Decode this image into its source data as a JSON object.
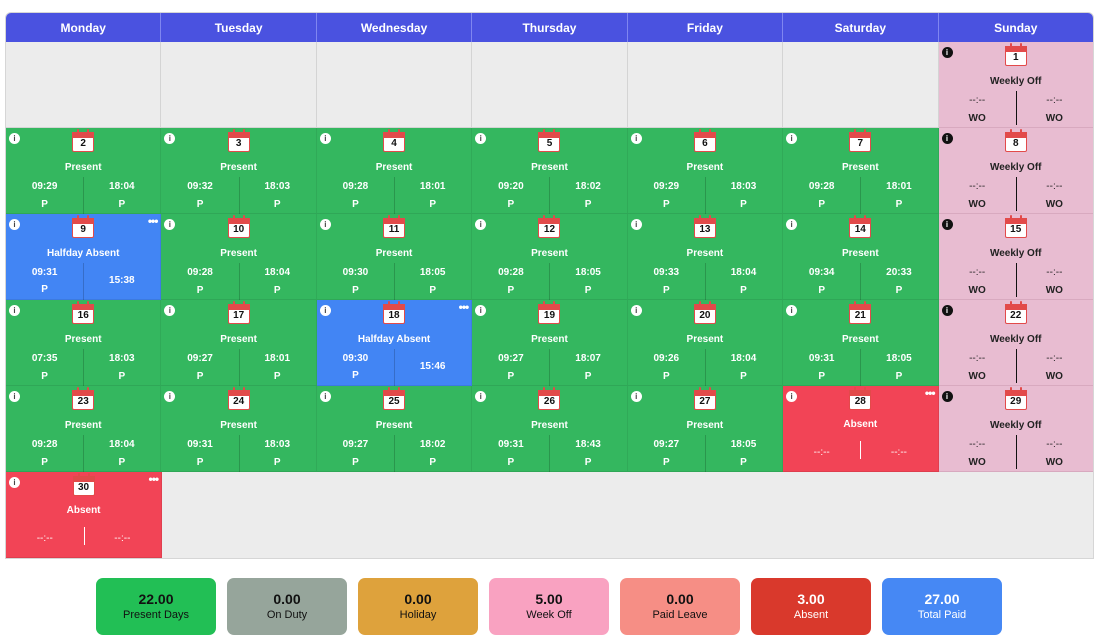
{
  "days": [
    "Monday",
    "Tuesday",
    "Wednesday",
    "Thursday",
    "Friday",
    "Saturday",
    "Sunday"
  ],
  "weeks": [
    [
      {
        "type": "empty"
      },
      {
        "type": "empty"
      },
      {
        "type": "empty"
      },
      {
        "type": "empty"
      },
      {
        "type": "empty"
      },
      {
        "type": "empty"
      },
      {
        "type": "weekoff",
        "date": "1",
        "status": "Weekly Off",
        "in": "--:--",
        "out": "--:--",
        "in_mark": "WO",
        "out_mark": "WO"
      }
    ],
    [
      {
        "type": "present",
        "date": "2",
        "status": "Present",
        "in": "09:29",
        "out": "18:04",
        "in_mark": "P",
        "out_mark": "P"
      },
      {
        "type": "present",
        "date": "3",
        "status": "Present",
        "in": "09:32",
        "out": "18:03",
        "in_mark": "P",
        "out_mark": "P"
      },
      {
        "type": "present",
        "date": "4",
        "status": "Present",
        "in": "09:28",
        "out": "18:01",
        "in_mark": "P",
        "out_mark": "P"
      },
      {
        "type": "present",
        "date": "5",
        "status": "Present",
        "in": "09:20",
        "out": "18:02",
        "in_mark": "P",
        "out_mark": "P"
      },
      {
        "type": "present",
        "date": "6",
        "status": "Present",
        "in": "09:29",
        "out": "18:03",
        "in_mark": "P",
        "out_mark": "P"
      },
      {
        "type": "present",
        "date": "7",
        "status": "Present",
        "in": "09:28",
        "out": "18:01",
        "in_mark": "P",
        "out_mark": "P"
      },
      {
        "type": "weekoff",
        "date": "8",
        "status": "Weekly Off",
        "in": "--:--",
        "out": "--:--",
        "in_mark": "WO",
        "out_mark": "WO"
      }
    ],
    [
      {
        "type": "halfday",
        "date": "9",
        "status": "Halfday Absent",
        "in": "09:31",
        "out": "15:38",
        "in_mark": "P",
        "out_mark": "",
        "more": "•••"
      },
      {
        "type": "present",
        "date": "10",
        "status": "Present",
        "in": "09:28",
        "out": "18:04",
        "in_mark": "P",
        "out_mark": "P"
      },
      {
        "type": "present",
        "date": "11",
        "status": "Present",
        "in": "09:30",
        "out": "18:05",
        "in_mark": "P",
        "out_mark": "P"
      },
      {
        "type": "present",
        "date": "12",
        "status": "Present",
        "in": "09:28",
        "out": "18:05",
        "in_mark": "P",
        "out_mark": "P"
      },
      {
        "type": "present",
        "date": "13",
        "status": "Present",
        "in": "09:33",
        "out": "18:04",
        "in_mark": "P",
        "out_mark": "P"
      },
      {
        "type": "present",
        "date": "14",
        "status": "Present",
        "in": "09:34",
        "out": "20:33",
        "in_mark": "P",
        "out_mark": "P"
      },
      {
        "type": "weekoff",
        "date": "15",
        "status": "Weekly Off",
        "in": "--:--",
        "out": "--:--",
        "in_mark": "WO",
        "out_mark": "WO"
      }
    ],
    [
      {
        "type": "present",
        "date": "16",
        "status": "Present",
        "in": "07:35",
        "out": "18:03",
        "in_mark": "P",
        "out_mark": "P"
      },
      {
        "type": "present",
        "date": "17",
        "status": "Present",
        "in": "09:27",
        "out": "18:01",
        "in_mark": "P",
        "out_mark": "P"
      },
      {
        "type": "halfday",
        "date": "18",
        "status": "Halfday Absent",
        "in": "09:30",
        "out": "15:46",
        "in_mark": "P",
        "out_mark": "",
        "more": "•••"
      },
      {
        "type": "present",
        "date": "19",
        "status": "Present",
        "in": "09:27",
        "out": "18:07",
        "in_mark": "P",
        "out_mark": "P"
      },
      {
        "type": "present",
        "date": "20",
        "status": "Present",
        "in": "09:26",
        "out": "18:04",
        "in_mark": "P",
        "out_mark": "P"
      },
      {
        "type": "present",
        "date": "21",
        "status": "Present",
        "in": "09:31",
        "out": "18:05",
        "in_mark": "P",
        "out_mark": "P"
      },
      {
        "type": "weekoff",
        "date": "22",
        "status": "Weekly Off",
        "in": "--:--",
        "out": "--:--",
        "in_mark": "WO",
        "out_mark": "WO"
      }
    ],
    [
      {
        "type": "present",
        "date": "23",
        "status": "Present",
        "in": "09:28",
        "out": "18:04",
        "in_mark": "P",
        "out_mark": "P"
      },
      {
        "type": "present",
        "date": "24",
        "status": "Present",
        "in": "09:31",
        "out": "18:03",
        "in_mark": "P",
        "out_mark": "P"
      },
      {
        "type": "present",
        "date": "25",
        "status": "Present",
        "in": "09:27",
        "out": "18:02",
        "in_mark": "P",
        "out_mark": "P"
      },
      {
        "type": "present",
        "date": "26",
        "status": "Present",
        "in": "09:31",
        "out": "18:43",
        "in_mark": "P",
        "out_mark": "P"
      },
      {
        "type": "present",
        "date": "27",
        "status": "Present",
        "in": "09:27",
        "out": "18:05",
        "in_mark": "P",
        "out_mark": "P"
      },
      {
        "type": "absent",
        "date": "28",
        "status": "Absent",
        "in": "--:--",
        "out": "--:--",
        "in_mark": "",
        "out_mark": "",
        "more": "•••"
      },
      {
        "type": "weekoff",
        "date": "29",
        "status": "Weekly Off",
        "in": "--:--",
        "out": "--:--",
        "in_mark": "WO",
        "out_mark": "WO"
      }
    ],
    [
      {
        "type": "absent",
        "date": "30",
        "status": "Absent",
        "in": "--:--",
        "out": "--:--",
        "in_mark": "",
        "out_mark": "",
        "more": "•••"
      },
      {
        "type": "empty"
      },
      {
        "type": "empty"
      },
      {
        "type": "empty"
      },
      {
        "type": "empty"
      },
      {
        "type": "empty"
      },
      {
        "type": "empty"
      }
    ]
  ],
  "info_glyph": "i",
  "summary": [
    {
      "value": "22.00",
      "label": "Present Days",
      "bg": "#22bf55",
      "fg": "#111111"
    },
    {
      "value": "0.00",
      "label": "On Duty",
      "bg": "#96a59b",
      "fg": "#111111"
    },
    {
      "value": "0.00",
      "label": "Holiday",
      "bg": "#dea23c",
      "fg": "#111111"
    },
    {
      "value": "5.00",
      "label": "Week Off",
      "bg": "#f9a2c1",
      "fg": "#111111"
    },
    {
      "value": "0.00",
      "label": "Paid Leave",
      "bg": "#f68e85",
      "fg": "#111111"
    },
    {
      "value": "3.00",
      "label": "Absent",
      "bg": "#d9392c",
      "fg": "#ffffff"
    },
    {
      "value": "27.00",
      "label": "Total Paid",
      "bg": "#4688f4",
      "fg": "#ffffff"
    }
  ],
  "colors": {
    "header": "#4a52e0",
    "present": "#34b75f",
    "halfday": "#4285f4",
    "absent": "#f24456",
    "weekoff": "#e8bcd1",
    "empty": "#ececec"
  }
}
